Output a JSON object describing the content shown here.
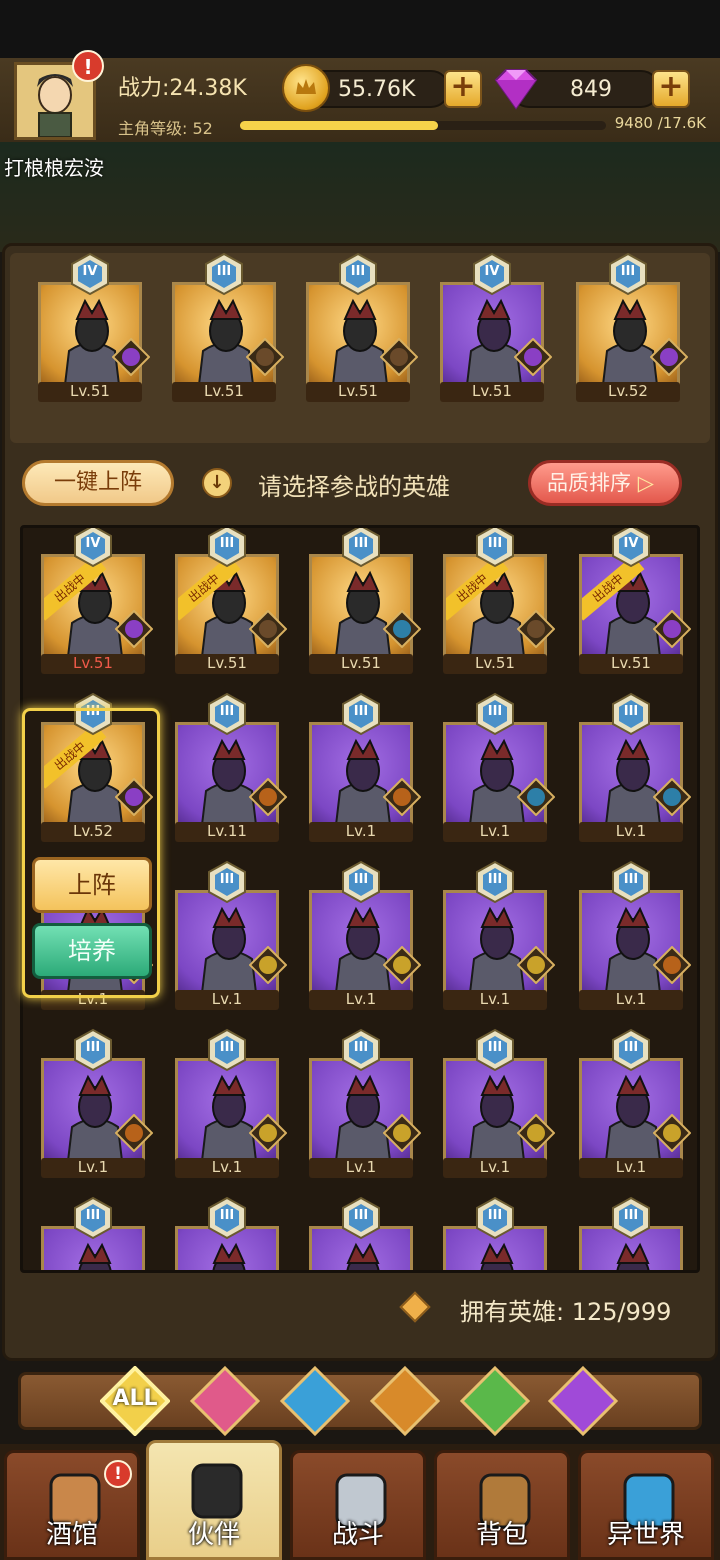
{
  "player": {
    "power": "战力:24.38K",
    "level_label": "主角等级:",
    "level": "52",
    "xp_text": "9480 /17.6K",
    "xp_fraction": 0.54,
    "name": "打桹桹宏洝"
  },
  "resources": {
    "gold": "55.76K",
    "gems": "849"
  },
  "team": [
    {
      "rank": "IV",
      "quality": "gold",
      "level": "Lv.51",
      "element": "demon"
    },
    {
      "rank": "III",
      "quality": "gold",
      "level": "Lv.51",
      "element": "knight"
    },
    {
      "rank": "III",
      "quality": "gold",
      "level": "Lv.51",
      "element": "knight"
    },
    {
      "rank": "IV",
      "quality": "purple",
      "level": "Lv.51",
      "element": "demon"
    },
    {
      "rank": "III",
      "quality": "gold",
      "level": "Lv.52",
      "element": "demon"
    }
  ],
  "toolbar": {
    "onekey_label": "一键上阵",
    "hint": "请选择参战的英雄",
    "sort_label": "品质排序"
  },
  "deployed_tag": "出战中",
  "roster": [
    {
      "rank": "IV",
      "quality": "gold",
      "level": "Lv.51",
      "element": "demon",
      "deployed": true,
      "lvl_red": true
    },
    {
      "rank": "III",
      "quality": "gold",
      "level": "Lv.51",
      "element": "knight",
      "deployed": true
    },
    {
      "rank": "III",
      "quality": "gold",
      "level": "Lv.51",
      "element": "elf"
    },
    {
      "rank": "III",
      "quality": "gold",
      "level": "Lv.51",
      "element": "knight",
      "deployed": true
    },
    {
      "rank": "IV",
      "quality": "purple",
      "level": "Lv.51",
      "element": "demon",
      "deployed": true
    },
    {
      "rank": "III",
      "quality": "gold",
      "level": "Lv.52",
      "element": "demon",
      "deployed": true
    },
    {
      "rank": "III",
      "quality": "purple",
      "level": "Lv.11",
      "element": "beast"
    },
    {
      "rank": "III",
      "quality": "purple",
      "level": "Lv.1",
      "element": "beast"
    },
    {
      "rank": "III",
      "quality": "purple",
      "level": "Lv.1",
      "element": "elf"
    },
    {
      "rank": "III",
      "quality": "purple",
      "level": "Lv.1",
      "element": "elf"
    },
    {
      "rank": "III",
      "quality": "purple",
      "level": "Lv.1",
      "element": "nature"
    },
    {
      "rank": "III",
      "quality": "purple",
      "level": "Lv.1",
      "element": "nature"
    },
    {
      "rank": "III",
      "quality": "purple",
      "level": "Lv.1",
      "element": "nature"
    },
    {
      "rank": "III",
      "quality": "purple",
      "level": "Lv.1",
      "element": "nature"
    },
    {
      "rank": "III",
      "quality": "purple",
      "level": "Lv.1",
      "element": "beast"
    },
    {
      "rank": "III",
      "quality": "purple",
      "level": "Lv.1",
      "element": "beast"
    },
    {
      "rank": "III",
      "quality": "purple",
      "level": "Lv.1",
      "element": "nature"
    },
    {
      "rank": "III",
      "quality": "purple",
      "level": "Lv.1",
      "element": "nature"
    },
    {
      "rank": "III",
      "quality": "purple",
      "level": "Lv.1",
      "element": "nature"
    },
    {
      "rank": "III",
      "quality": "purple",
      "level": "Lv.1",
      "element": "nature"
    },
    {
      "rank": "III",
      "quality": "purple",
      "level": "",
      "element": ""
    },
    {
      "rank": "III",
      "quality": "purple",
      "level": "",
      "element": ""
    },
    {
      "rank": "III",
      "quality": "purple",
      "level": "",
      "element": ""
    },
    {
      "rank": "III",
      "quality": "purple",
      "level": "",
      "element": ""
    },
    {
      "rank": "III",
      "quality": "purple",
      "level": "",
      "element": ""
    }
  ],
  "selected_actions": {
    "deploy": "上阵",
    "train": "培养"
  },
  "hero_count": "拥有英雄: 125/999",
  "filters": [
    {
      "label": "ALL",
      "icon": "all-icon"
    },
    {
      "label": "",
      "icon": "knight-faction-icon"
    },
    {
      "label": "",
      "icon": "elf-faction-icon"
    },
    {
      "label": "",
      "icon": "beast-faction-icon"
    },
    {
      "label": "",
      "icon": "nature-faction-icon"
    },
    {
      "label": "",
      "icon": "demon-faction-icon"
    }
  ],
  "nav": [
    {
      "label": "酒馆",
      "icon": "beer-mug-icon"
    },
    {
      "label": "伙伴",
      "icon": "partner-icon"
    },
    {
      "label": "战斗",
      "icon": "crossed-swords-icon"
    },
    {
      "label": "背包",
      "icon": "backpack-icon"
    },
    {
      "label": "异世界",
      "icon": "portal-icon"
    }
  ],
  "colors": {
    "gold_card": "#d6942f",
    "purple_card": "#7c47c4",
    "accent_yellow": "#f2d04a",
    "sort_red": "#e3584c",
    "train_green": "#2caa78"
  }
}
